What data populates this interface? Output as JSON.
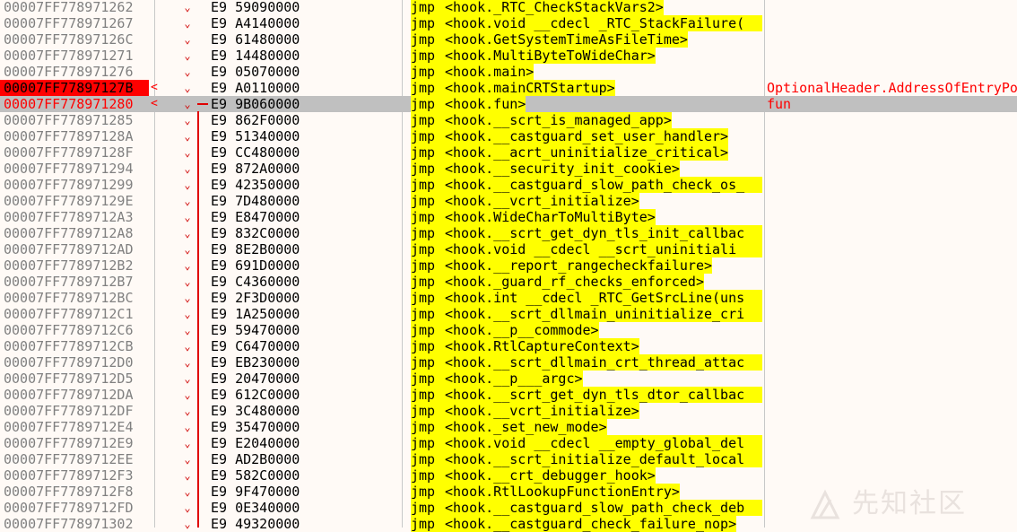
{
  "watermark_text": "先知社区",
  "rows": [
    {
      "addr": "00007FF778971262",
      "mark": "",
      "bytes": "E9 59090000",
      "mnemonic": "jmp",
      "operand": "<hook._RTC_CheckStackVars2>",
      "clip": false,
      "comment": "",
      "state": ""
    },
    {
      "addr": "00007FF778971267",
      "mark": "",
      "bytes": "E9 A4140000",
      "mnemonic": "jmp",
      "operand": "<hook.void __cdecl _RTC_StackFailure(",
      "clip": true,
      "comment": "",
      "state": ""
    },
    {
      "addr": "00007FF77897126C",
      "mark": "",
      "bytes": "E9 61480000",
      "mnemonic": "jmp",
      "operand": "<hook.GetSystemTimeAsFileTime>",
      "clip": false,
      "comment": "",
      "state": ""
    },
    {
      "addr": "00007FF778971271",
      "mark": "",
      "bytes": "E9 14480000",
      "mnemonic": "jmp",
      "operand": "<hook.MultiByteToWideChar>",
      "clip": false,
      "comment": "",
      "state": ""
    },
    {
      "addr": "00007FF778971276",
      "mark": "",
      "bytes": "E9 05070000",
      "mnemonic": "jmp",
      "operand": "<hook.main>",
      "clip": false,
      "comment": "",
      "state": ""
    },
    {
      "addr": "00007FF77897127B",
      "mark": "<",
      "bytes": "E9 A0110000",
      "mnemonic": "jmp",
      "operand": "<hook.mainCRTStartup>",
      "clip": false,
      "comment": "OptionalHeader.AddressOfEntryPoint",
      "state": "entry"
    },
    {
      "addr": "00007FF778971280",
      "mark": "<",
      "bytes": "E9 9B060000",
      "mnemonic": "jmp",
      "operand": "<hook.fun>",
      "clip": false,
      "comment": "fun",
      "state": "highlighted"
    },
    {
      "addr": "00007FF778971285",
      "mark": "",
      "bytes": "E9 862F0000",
      "mnemonic": "jmp",
      "operand": "<hook.__scrt_is_managed_app>",
      "clip": false,
      "comment": "",
      "state": ""
    },
    {
      "addr": "00007FF77897128A",
      "mark": "",
      "bytes": "E9 51340000",
      "mnemonic": "jmp",
      "operand": "<hook.__castguard_set_user_handler>",
      "clip": false,
      "comment": "",
      "state": ""
    },
    {
      "addr": "00007FF77897128F",
      "mark": "",
      "bytes": "E9 CC480000",
      "mnemonic": "jmp",
      "operand": "<hook.__acrt_uninitialize_critical>",
      "clip": false,
      "comment": "",
      "state": ""
    },
    {
      "addr": "00007FF778971294",
      "mark": "",
      "bytes": "E9 872A0000",
      "mnemonic": "jmp",
      "operand": "<hook.__security_init_cookie>",
      "clip": false,
      "comment": "",
      "state": ""
    },
    {
      "addr": "00007FF778971299",
      "mark": "",
      "bytes": "E9 42350000",
      "mnemonic": "jmp",
      "operand": "<hook.__castguard_slow_path_check_os_",
      "clip": true,
      "comment": "",
      "state": ""
    },
    {
      "addr": "00007FF77897129E",
      "mark": "",
      "bytes": "E9 7D480000",
      "mnemonic": "jmp",
      "operand": "<hook.__vcrt_initialize>",
      "clip": false,
      "comment": "",
      "state": ""
    },
    {
      "addr": "00007FF7789712A3",
      "mark": "",
      "bytes": "E9 E8470000",
      "mnemonic": "jmp",
      "operand": "<hook.WideCharToMultiByte>",
      "clip": false,
      "comment": "",
      "state": ""
    },
    {
      "addr": "00007FF7789712A8",
      "mark": "",
      "bytes": "E9 832C0000",
      "mnemonic": "jmp",
      "operand": "<hook.__scrt_get_dyn_tls_init_callbac",
      "clip": true,
      "comment": "",
      "state": ""
    },
    {
      "addr": "00007FF7789712AD",
      "mark": "",
      "bytes": "E9 8E2B0000",
      "mnemonic": "jmp",
      "operand": "<hook.void __cdecl __scrt_uninitiali",
      "clip": true,
      "comment": "",
      "state": ""
    },
    {
      "addr": "00007FF7789712B2",
      "mark": "",
      "bytes": "E9 691D0000",
      "mnemonic": "jmp",
      "operand": "<hook.__report_rangecheckfailure>",
      "clip": false,
      "comment": "",
      "state": ""
    },
    {
      "addr": "00007FF7789712B7",
      "mark": "",
      "bytes": "E9 C4360000",
      "mnemonic": "jmp",
      "operand": "<hook._guard_rf_checks_enforced>",
      "clip": false,
      "comment": "",
      "state": ""
    },
    {
      "addr": "00007FF7789712BC",
      "mark": "",
      "bytes": "E9 2F3D0000",
      "mnemonic": "jmp",
      "operand": "<hook.int __cdecl _RTC_GetSrcLine(uns",
      "clip": true,
      "comment": "",
      "state": ""
    },
    {
      "addr": "00007FF7789712C1",
      "mark": "",
      "bytes": "E9 1A250000",
      "mnemonic": "jmp",
      "operand": "<hook.__scrt_dllmain_uninitialize_cri",
      "clip": true,
      "comment": "",
      "state": ""
    },
    {
      "addr": "00007FF7789712C6",
      "mark": "",
      "bytes": "E9 59470000",
      "mnemonic": "jmp",
      "operand": "<hook.__p__commode>",
      "clip": false,
      "comment": "",
      "state": ""
    },
    {
      "addr": "00007FF7789712CB",
      "mark": "",
      "bytes": "E9 C6470000",
      "mnemonic": "jmp",
      "operand": "<hook.RtlCaptureContext>",
      "clip": false,
      "comment": "",
      "state": ""
    },
    {
      "addr": "00007FF7789712D0",
      "mark": "",
      "bytes": "E9 EB230000",
      "mnemonic": "jmp",
      "operand": "<hook.__scrt_dllmain_crt_thread_attac",
      "clip": true,
      "comment": "",
      "state": ""
    },
    {
      "addr": "00007FF7789712D5",
      "mark": "",
      "bytes": "E9 20470000",
      "mnemonic": "jmp",
      "operand": "<hook.__p___argc>",
      "clip": false,
      "comment": "",
      "state": ""
    },
    {
      "addr": "00007FF7789712DA",
      "mark": "",
      "bytes": "E9 612C0000",
      "mnemonic": "jmp",
      "operand": "<hook.__scrt_get_dyn_tls_dtor_callbac",
      "clip": true,
      "comment": "",
      "state": ""
    },
    {
      "addr": "00007FF7789712DF",
      "mark": "",
      "bytes": "E9 3C480000",
      "mnemonic": "jmp",
      "operand": "<hook.__vcrt_initialize>",
      "clip": false,
      "comment": "",
      "state": ""
    },
    {
      "addr": "00007FF7789712E4",
      "mark": "",
      "bytes": "E9 35470000",
      "mnemonic": "jmp",
      "operand": "<hook._set_new_mode>",
      "clip": false,
      "comment": "",
      "state": ""
    },
    {
      "addr": "00007FF7789712E9",
      "mark": "",
      "bytes": "E9 E2040000",
      "mnemonic": "jmp",
      "operand": "<hook.void __cdecl __empty_global_del",
      "clip": true,
      "comment": "",
      "state": ""
    },
    {
      "addr": "00007FF7789712EE",
      "mark": "",
      "bytes": "E9 AD2B0000",
      "mnemonic": "jmp",
      "operand": "<hook.__scrt_initialize_default_local",
      "clip": true,
      "comment": "",
      "state": ""
    },
    {
      "addr": "00007FF7789712F3",
      "mark": "",
      "bytes": "E9 582C0000",
      "mnemonic": "jmp",
      "operand": "<hook.__crt_debugger_hook>",
      "clip": false,
      "comment": "",
      "state": ""
    },
    {
      "addr": "00007FF7789712F8",
      "mark": "",
      "bytes": "E9 9F470000",
      "mnemonic": "jmp",
      "operand": "<hook.RtlLookupFunctionEntry>",
      "clip": false,
      "comment": "",
      "state": ""
    },
    {
      "addr": "00007FF7789712FD",
      "mark": "",
      "bytes": "E9 0E340000",
      "mnemonic": "jmp",
      "operand": "<hook.__castguard_slow_path_check_deb",
      "clip": true,
      "comment": "",
      "state": ""
    },
    {
      "addr": "00007FF778971302",
      "mark": "",
      "bytes": "E9 49320000",
      "mnemonic": "jmp",
      "operand": "<hook.__castguard_check_failure_nop>",
      "clip": false,
      "comment": "",
      "state": ""
    }
  ]
}
